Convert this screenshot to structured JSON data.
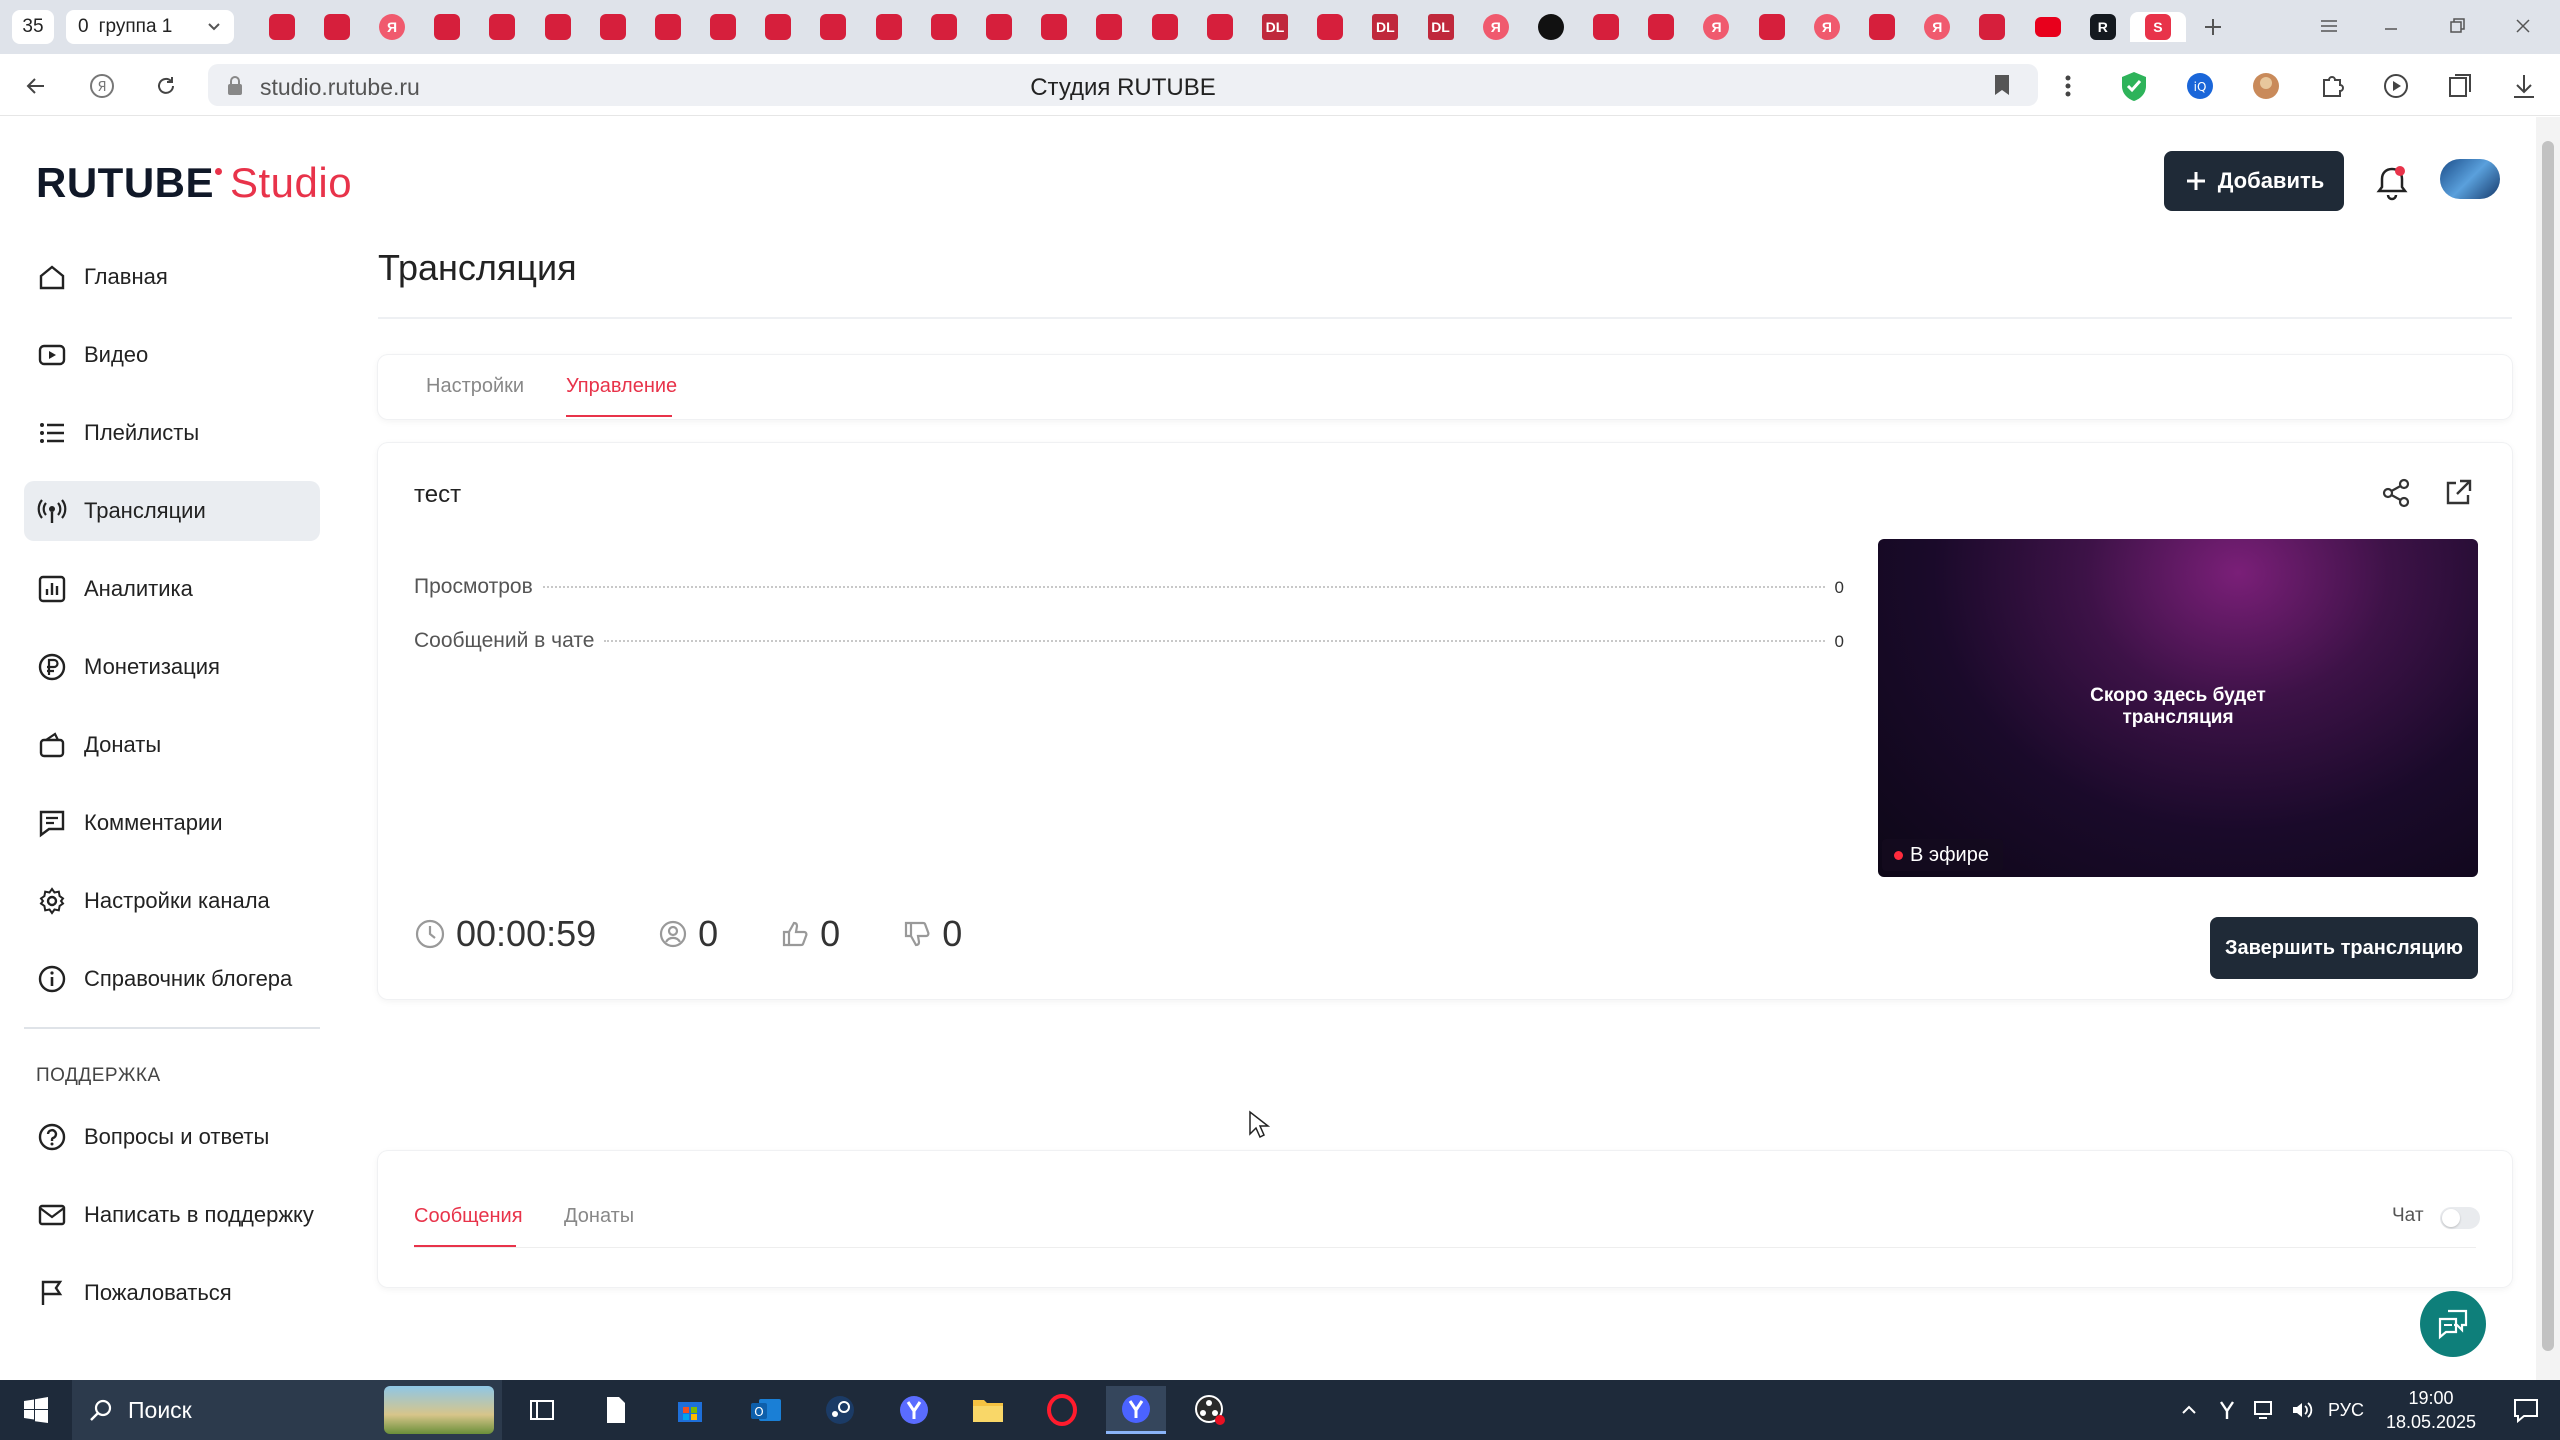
{
  "browser": {
    "tab_count": "35",
    "tab_group_count": "0",
    "tab_group_name": "группа 1",
    "url": "studio.rutube.ru",
    "page_title": "Студия RUTUBE"
  },
  "app": {
    "logo_main": "RUTUBE",
    "logo_studio": "Studio",
    "add_button": "Добавить"
  },
  "sidebar": {
    "items": [
      {
        "label": "Главная",
        "icon": "home-icon"
      },
      {
        "label": "Видео",
        "icon": "video-icon"
      },
      {
        "label": "Плейлисты",
        "icon": "playlist-icon"
      },
      {
        "label": "Трансляции",
        "icon": "broadcast-icon"
      },
      {
        "label": "Аналитика",
        "icon": "analytics-icon"
      },
      {
        "label": "Монетизация",
        "icon": "ruble-icon"
      },
      {
        "label": "Донаты",
        "icon": "donate-icon"
      },
      {
        "label": "Комментарии",
        "icon": "comment-icon"
      },
      {
        "label": "Настройки канала",
        "icon": "gear-icon"
      },
      {
        "label": "Справочник блогера",
        "icon": "info-icon"
      }
    ],
    "support_heading": "ПОДДЕРЖКА",
    "support_items": [
      {
        "label": "Вопросы и ответы",
        "icon": "question-icon"
      },
      {
        "label": "Написать в поддержку",
        "icon": "mail-icon"
      },
      {
        "label": "Пожаловаться",
        "icon": "flag-icon"
      }
    ]
  },
  "main": {
    "title": "Трансляция",
    "tabs": [
      {
        "label": "Настройки",
        "active": false
      },
      {
        "label": "Управление",
        "active": true
      }
    ],
    "stream": {
      "name": "тест",
      "stats": [
        {
          "label": "Просмотров",
          "value": "0"
        },
        {
          "label": "Сообщений в чате",
          "value": "0"
        }
      ],
      "preview_text_line1": "Скоро здесь будет",
      "preview_text_line2": "трансляция",
      "live_badge": "В эфире",
      "duration": "00:00:59",
      "viewers": "0",
      "likes": "0",
      "dislikes": "0",
      "end_button": "Завершить трансляцию"
    },
    "chat": {
      "tabs": [
        {
          "label": "Сообщения",
          "active": true
        },
        {
          "label": "Донаты",
          "active": false
        }
      ],
      "toggle_label": "Чат",
      "toggle_on": false
    }
  },
  "taskbar": {
    "search_label": "Поиск",
    "language": "РУС",
    "time": "19:00",
    "date": "18.05.2025"
  },
  "colors": {
    "accent": "#e8334a",
    "dark_button": "#1f2a37",
    "help_fab": "#0e7f7a"
  }
}
